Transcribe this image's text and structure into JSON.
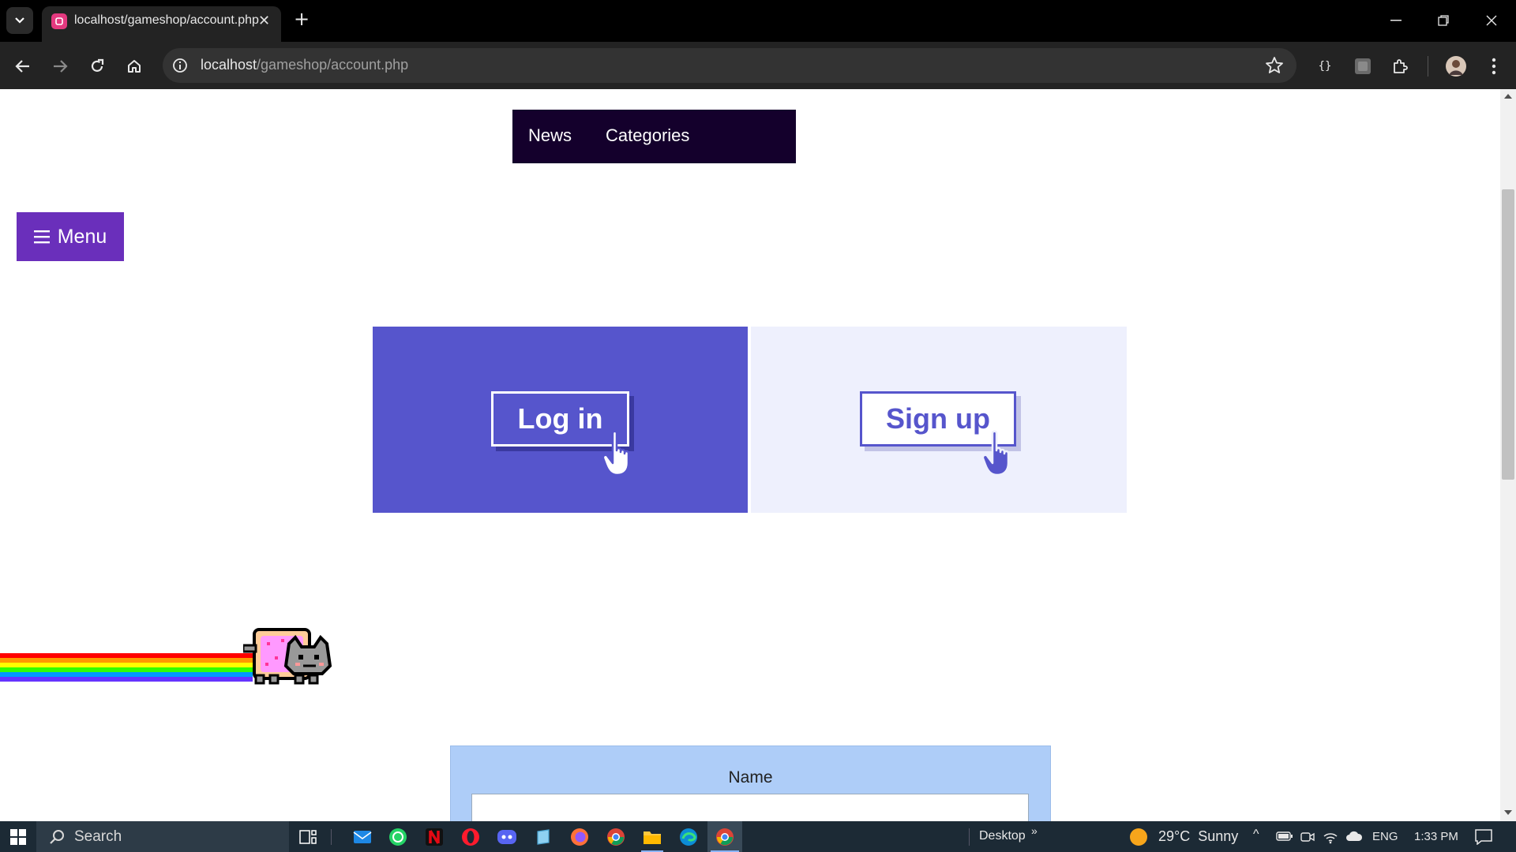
{
  "browser": {
    "tab_title": "localhost/gameshop/account.php",
    "url_host": "localhost",
    "url_path": "/gameshop/account.php",
    "accent_color": "#e4397f"
  },
  "page": {
    "nav": {
      "news": "News",
      "categories": "Categories"
    },
    "menu_button": "Menu",
    "login_button": "Log in",
    "signup_button": "Sign up",
    "form": {
      "name_label": "Name",
      "name_value": ""
    },
    "colors": {
      "nav_bg": "#14002c",
      "menu_bg": "#6a2fbb",
      "login_bg": "#5655cc",
      "signup_bg": "#eef0fd",
      "form_bg": "#aecdf8"
    }
  },
  "taskbar": {
    "search_placeholder": "Search",
    "desktop_label": "Desktop",
    "weather": "29°C  Sunny",
    "language": "ENG",
    "time": "1:33 PM",
    "apps": [
      "task-view",
      "mail",
      "whatsapp",
      "netflix",
      "opera",
      "discord",
      "notepad",
      "firefox",
      "chrome",
      "file-explorer",
      "edge",
      "chrome-active"
    ]
  }
}
